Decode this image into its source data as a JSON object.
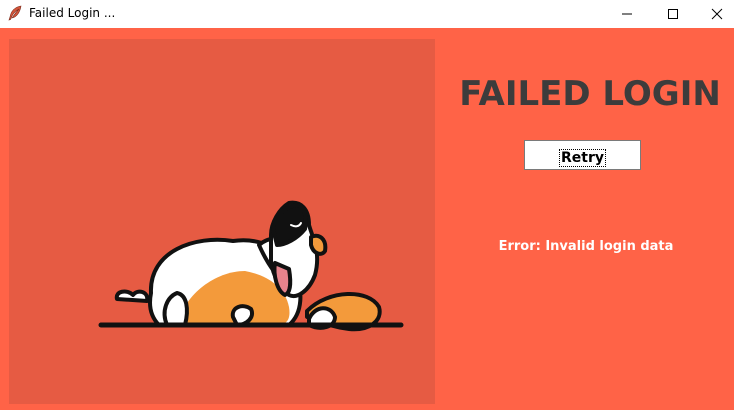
{
  "window": {
    "title": "Failed Login ...",
    "app_icon": "feather-icon",
    "controls": [
      "minimize-icon",
      "maximize-icon",
      "close-icon"
    ]
  },
  "main": {
    "heading": "FAILED LOGIN",
    "retry_label": "Retry",
    "error_message": "Error: Invalid login data",
    "illustration": "sleeping-dog-illustration"
  },
  "colors": {
    "background": "#ff6347",
    "image_panel": "#e65b43",
    "heading": "#3c3c3c",
    "error_text": "#ffffff",
    "dog_orange": "#f39a3b",
    "dog_outline": "#111111"
  }
}
